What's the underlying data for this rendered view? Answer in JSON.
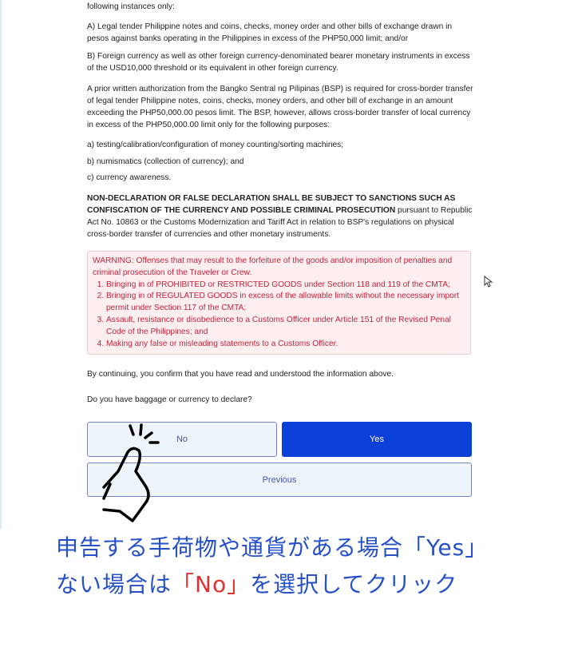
{
  "content": {
    "intro": "following instances only:",
    "item_A": "A) Legal tender Philippine notes and coins, checks, money order and other bills of exchange drawn in pesos against banks operating in the Philippines in excess of the PHP50,000 limit; and/or",
    "item_B": "B) Foreign currency as well as other foreign currency-denominated bearer monetary instruments in excess of the USD10,000 threshold or its equivalent in other foreign currency.",
    "bsp_paragraph": "A prior written authorization from the Bangko Sentral ng Pilipinas (BSP) is required for cross-border transfer of legal tender Philippine notes, coins, checks, money orders, and other bill of exchange in an amount exceeding the PHP50,000.00 pesos limit. The BSP, however, allows cross-border transfer of local currency in excess of the PHP50,000.00 limit only for the following purposes:",
    "purpose_a": "a) testing/calibration/configuration of money counting/sorting machines;",
    "purpose_b": "b) numismatics (collection of currency); and",
    "purpose_c": "c) currency awareness.",
    "sanction_bold": "NON-DECLARATION OR FALSE DECLARATION SHALL BE SUBJECT TO SANCTIONS SUCH AS CONFISCATION OF THE CURRENCY AND POSSIBLE CRIMINAL PROSECUTION",
    "sanction_rest": " pursuant to Republic Act No. 10863 or the Customs Modernization and Tariff Act in relation to BSP's regulations on physical cross-border transfer of currencies and other monetary instruments."
  },
  "warning": {
    "heading": "WARNING: Offenses that may result to the forfeiture of the goods and/or imposition of penalties and criminal prosecution of the Traveler or Crew.",
    "items": [
      "Bringing in of PROHIBITED or RESTRICTED GOODS under Section 118 and 119 of the CMTA;",
      "Bringing in of REGULATED GOODS in excess of the allowable limits without the necessary import permit under Section 117 of the CMTA;",
      "Assault, resistance or disobedience to a Customs Officer under Article 151 of the Revised Penal Code of the Philippines; and",
      "Making any false or misleading statements to a Customs Officer."
    ]
  },
  "confirm_text": "By continuing, you confirm that you have read and understood the information above.",
  "question": "Do you have baggage or currency to declare?",
  "buttons": {
    "no": "No",
    "yes": "Yes",
    "previous": "Previous"
  },
  "annotation": {
    "line1": "申告する手荷物や通貨がある場合「Yes」",
    "line2_a": "ない場合は",
    "line2_b": "「No」",
    "line2_c": "を選択してクリック"
  },
  "colors": {
    "primary": "#0a3fd8",
    "warning_text": "#c0243a",
    "annotation_blue": "#2550c8",
    "annotation_red": "#e0302f"
  }
}
